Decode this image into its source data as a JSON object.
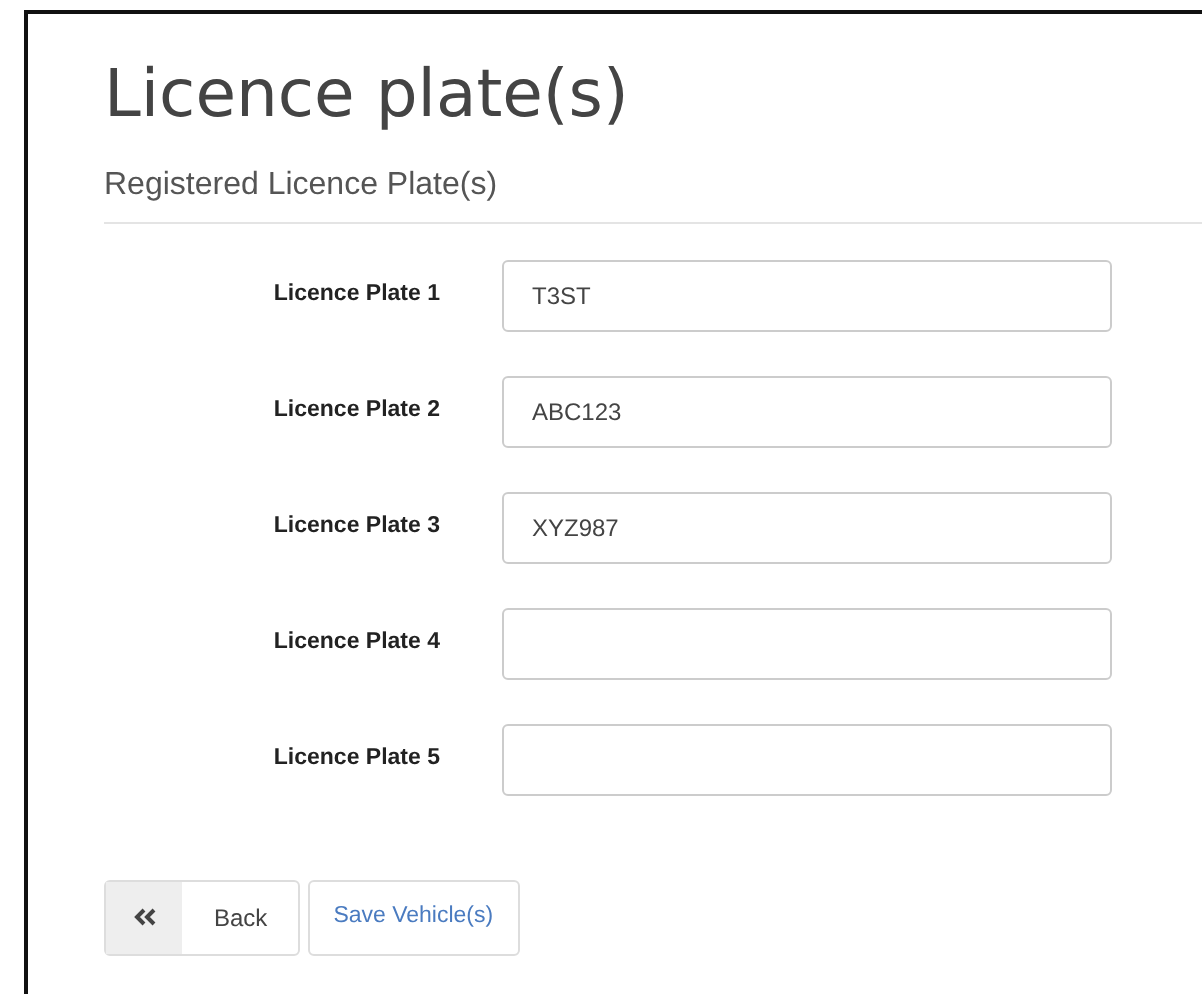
{
  "page": {
    "title": "Licence plate(s)",
    "subtitle": "Registered Licence Plate(s)"
  },
  "plates": [
    {
      "label": "Licence Plate 1",
      "value": "T3ST"
    },
    {
      "label": "Licence Plate 2",
      "value": "ABC123"
    },
    {
      "label": "Licence Plate 3",
      "value": "XYZ987"
    },
    {
      "label": "Licence Plate 4"
    },
    {
      "label": "Licence Plate 5"
    }
  ],
  "buttons": {
    "back": "Back",
    "save": "Save Vehicle(s)"
  }
}
